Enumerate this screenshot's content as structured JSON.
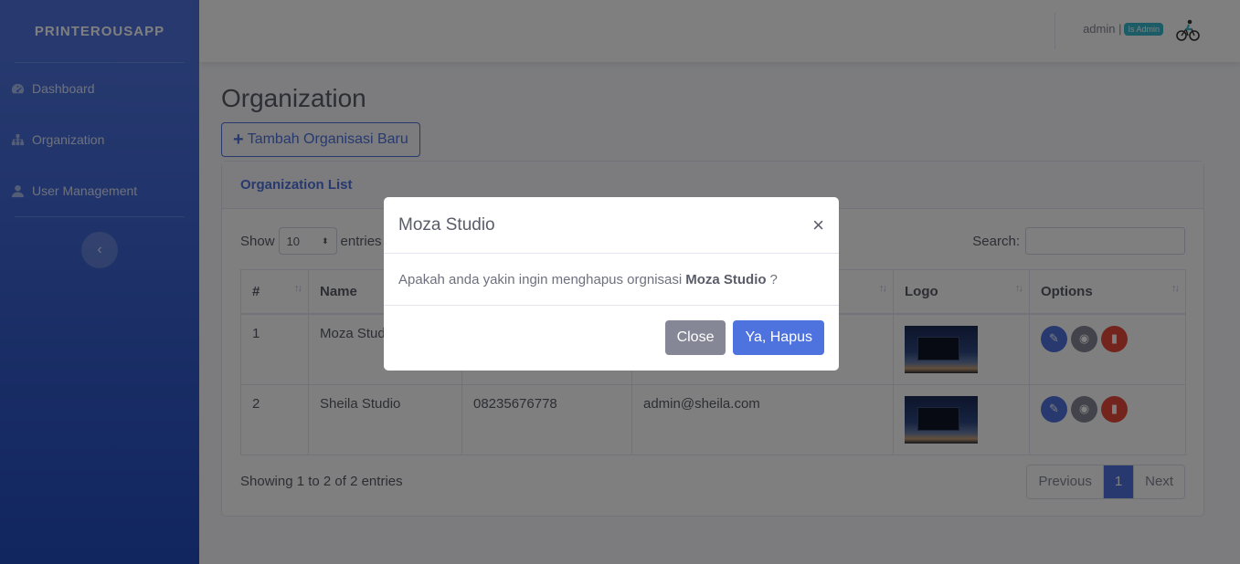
{
  "sidebar": {
    "brand": "PRINTEROUSAPP",
    "items": [
      {
        "label": "Dashboard",
        "icon": "tachometer-icon"
      },
      {
        "label": "Organization",
        "icon": "sitemap-icon"
      },
      {
        "label": "User Management",
        "icon": "user-icon"
      }
    ],
    "toggle_glyph": "‹"
  },
  "topbar": {
    "user_label": "admin |",
    "role_badge": "Is Admin"
  },
  "main": {
    "page_title": "Organization",
    "add_button": "Tambah Organisasi Baru",
    "card_title": "Organization List",
    "show_label": "Show",
    "length_value": "10",
    "entries_label": "entries",
    "search_label": "Search:",
    "columns": [
      "#",
      "Name",
      "",
      "",
      "Logo",
      "Options"
    ],
    "rows": [
      {
        "no": "1",
        "name": "Moza Studio",
        "phone": "",
        "email": ""
      },
      {
        "no": "2",
        "name": "Sheila Studio",
        "phone": "08235676778",
        "email": "admin@sheila.com"
      }
    ],
    "info": "Showing 1 to 2 of 2 entries",
    "pagination": {
      "previous": "Previous",
      "current": "1",
      "next": "Next"
    }
  },
  "modal": {
    "title": "Moza Studio",
    "close_glyph": "×",
    "message_prefix": "Apakah anda yakin ingin menghapus orgnisasi",
    "message_name": "Moza Studio",
    "message_suffix": "?",
    "close_button": "Close",
    "confirm_button": "Ya, Hapus"
  },
  "colors": {
    "primary": "#4e73df",
    "secondary": "#858796",
    "danger": "#e74a3b",
    "info": "#36b9cc"
  }
}
